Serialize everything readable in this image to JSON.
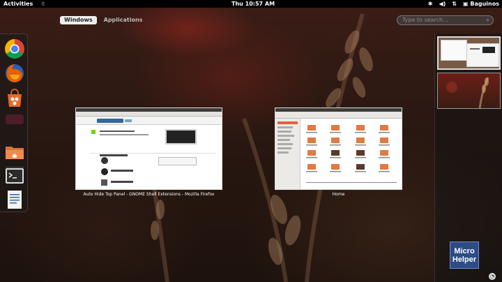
{
  "topbar": {
    "activities": "Activities",
    "clock": "Thu 10:57 AM",
    "user": "Baguinos"
  },
  "view_selector": {
    "tabs": [
      {
        "label": "Windows",
        "active": true
      },
      {
        "label": "Applications",
        "active": false
      }
    ]
  },
  "search": {
    "placeholder": "Type to search..."
  },
  "dash": {
    "items": [
      "chrome-icon",
      "firefox-icon",
      "software-center-icon",
      "files-icon",
      "terminal-icon",
      "text-editor-icon"
    ]
  },
  "windows": [
    {
      "caption": "Auto Hide Top Panel - GNOME Shell Extensions - Mozilla Firefox"
    },
    {
      "caption": "Home"
    }
  ],
  "watermark": {
    "line1": "Micro",
    "line2": "Helper"
  },
  "colors": {
    "topbar": "#000000",
    "logo": "#2b4c86",
    "active_tab": "#eeeeee"
  }
}
